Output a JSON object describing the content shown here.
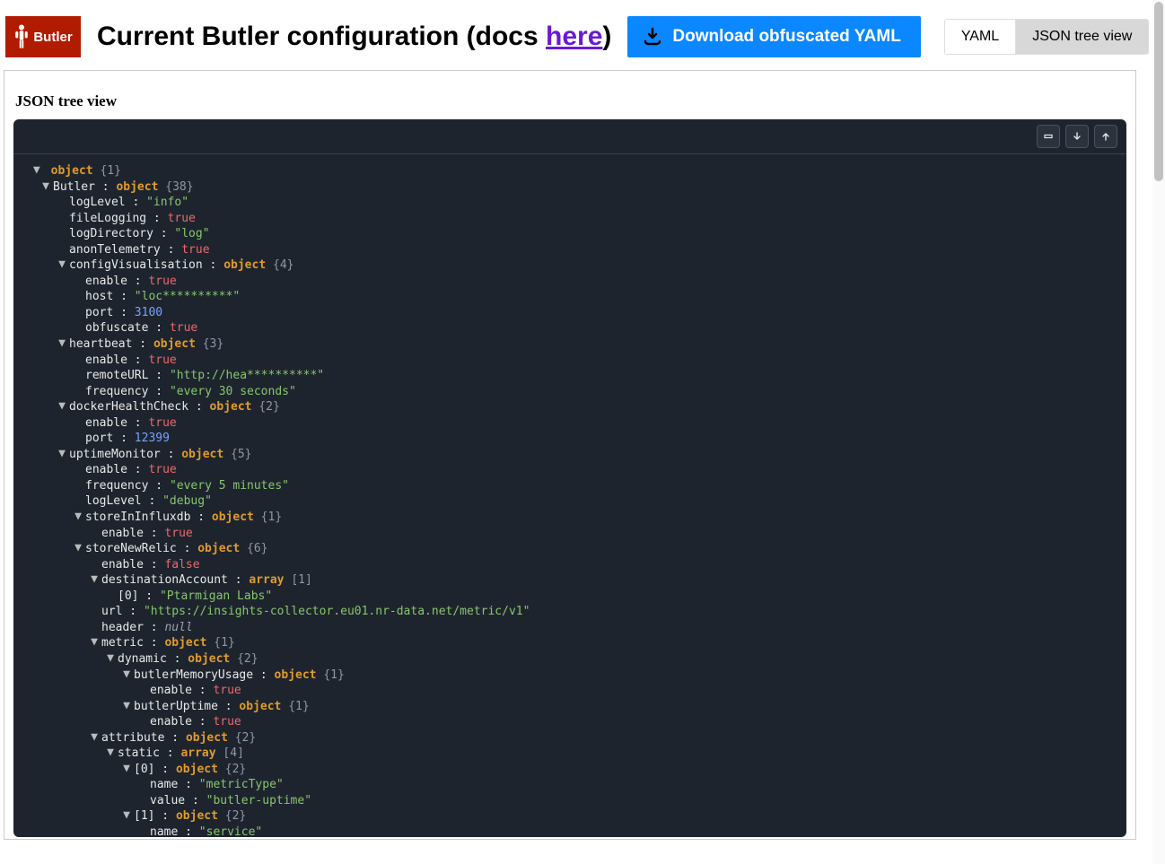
{
  "logo": {
    "text": "Butler"
  },
  "title": {
    "prefix": "Current Butler configuration (docs ",
    "link": "here",
    "suffix": ")"
  },
  "download_btn": "Download obfuscated YAML",
  "tabs": {
    "yaml": "YAML",
    "json": "JSON tree view"
  },
  "section_heading": "JSON tree view",
  "tree_root": {
    "label": "object",
    "count": "{1}"
  },
  "rows": [
    {
      "depth": 1,
      "toggle": true,
      "key": "Butler",
      "sep": " : ",
      "type": "object",
      "count": "{38}"
    },
    {
      "depth": 2,
      "key": "logLevel",
      "sep": " : ",
      "valueKind": "str",
      "value": "\"info\""
    },
    {
      "depth": 2,
      "key": "fileLogging",
      "sep": " : ",
      "valueKind": "bool",
      "value": "true"
    },
    {
      "depth": 2,
      "key": "logDirectory",
      "sep": " : ",
      "valueKind": "str",
      "value": "\"log\""
    },
    {
      "depth": 2,
      "key": "anonTelemetry",
      "sep": " : ",
      "valueKind": "bool",
      "value": "true"
    },
    {
      "depth": 2,
      "toggle": true,
      "key": "configVisualisation",
      "sep": " : ",
      "type": "object",
      "count": "{4}"
    },
    {
      "depth": 3,
      "key": "enable",
      "sep": " : ",
      "valueKind": "bool",
      "value": "true"
    },
    {
      "depth": 3,
      "key": "host",
      "sep": " : ",
      "valueKind": "str",
      "value": "\"loc**********\""
    },
    {
      "depth": 3,
      "key": "port",
      "sep": " : ",
      "valueKind": "num",
      "value": "3100"
    },
    {
      "depth": 3,
      "key": "obfuscate",
      "sep": " : ",
      "valueKind": "bool",
      "value": "true"
    },
    {
      "depth": 2,
      "toggle": true,
      "key": "heartbeat",
      "sep": " : ",
      "type": "object",
      "count": "{3}"
    },
    {
      "depth": 3,
      "key": "enable",
      "sep": " : ",
      "valueKind": "bool",
      "value": "true"
    },
    {
      "depth": 3,
      "key": "remoteURL",
      "sep": " : ",
      "valueKind": "str",
      "value": "\"http://hea**********\""
    },
    {
      "depth": 3,
      "key": "frequency",
      "sep": " : ",
      "valueKind": "str",
      "value": "\"every 30 seconds\""
    },
    {
      "depth": 2,
      "toggle": true,
      "key": "dockerHealthCheck",
      "sep": " : ",
      "type": "object",
      "count": "{2}"
    },
    {
      "depth": 3,
      "key": "enable",
      "sep": " : ",
      "valueKind": "bool",
      "value": "true"
    },
    {
      "depth": 3,
      "key": "port",
      "sep": " : ",
      "valueKind": "num",
      "value": "12399"
    },
    {
      "depth": 2,
      "toggle": true,
      "key": "uptimeMonitor",
      "sep": " : ",
      "type": "object",
      "count": "{5}"
    },
    {
      "depth": 3,
      "key": "enable",
      "sep": " : ",
      "valueKind": "bool",
      "value": "true"
    },
    {
      "depth": 3,
      "key": "frequency",
      "sep": " : ",
      "valueKind": "str",
      "value": "\"every 5 minutes\""
    },
    {
      "depth": 3,
      "key": "logLevel",
      "sep": " : ",
      "valueKind": "str",
      "value": "\"debug\""
    },
    {
      "depth": 3,
      "toggle": true,
      "key": "storeInInfluxdb",
      "sep": " : ",
      "type": "object",
      "count": "{1}"
    },
    {
      "depth": 4,
      "key": "enable",
      "sep": " : ",
      "valueKind": "bool",
      "value": "true"
    },
    {
      "depth": 3,
      "toggle": true,
      "key": "storeNewRelic",
      "sep": " : ",
      "type": "object",
      "count": "{6}"
    },
    {
      "depth": 4,
      "key": "enable",
      "sep": " : ",
      "valueKind": "bool",
      "value": "false"
    },
    {
      "depth": 4,
      "toggle": true,
      "key": "destinationAccount",
      "sep": " : ",
      "type": "array",
      "count": "[1]"
    },
    {
      "depth": 5,
      "key": "[0]",
      "sep": " : ",
      "valueKind": "str",
      "value": "\"Ptarmigan Labs\""
    },
    {
      "depth": 4,
      "key": "url",
      "sep": " : ",
      "valueKind": "str",
      "value": "\"https://insights-collector.eu01.nr-data.net/metric/v1\""
    },
    {
      "depth": 4,
      "key": "header",
      "sep": " : ",
      "valueKind": "null",
      "value": "null"
    },
    {
      "depth": 4,
      "toggle": true,
      "key": "metric",
      "sep": " : ",
      "type": "object",
      "count": "{1}"
    },
    {
      "depth": 5,
      "toggle": true,
      "key": "dynamic",
      "sep": " : ",
      "type": "object",
      "count": "{2}"
    },
    {
      "depth": 6,
      "toggle": true,
      "key": "butlerMemoryUsage",
      "sep": " : ",
      "type": "object",
      "count": "{1}"
    },
    {
      "depth": 7,
      "key": "enable",
      "sep": " : ",
      "valueKind": "bool",
      "value": "true"
    },
    {
      "depth": 6,
      "toggle": true,
      "key": "butlerUptime",
      "sep": " : ",
      "type": "object",
      "count": "{1}"
    },
    {
      "depth": 7,
      "key": "enable",
      "sep": " : ",
      "valueKind": "bool",
      "value": "true"
    },
    {
      "depth": 4,
      "toggle": true,
      "key": "attribute",
      "sep": " : ",
      "type": "object",
      "count": "{2}"
    },
    {
      "depth": 5,
      "toggle": true,
      "key": "static",
      "sep": " : ",
      "type": "array",
      "count": "[4]"
    },
    {
      "depth": 6,
      "toggle": true,
      "key": "[0]",
      "sep": " : ",
      "type": "object",
      "count": "{2}"
    },
    {
      "depth": 7,
      "key": "name",
      "sep": " : ",
      "valueKind": "str",
      "value": "\"metricType\""
    },
    {
      "depth": 7,
      "key": "value",
      "sep": " : ",
      "valueKind": "str",
      "value": "\"butler-uptime\""
    },
    {
      "depth": 6,
      "toggle": true,
      "key": "[1]",
      "sep": " : ",
      "type": "object",
      "count": "{2}"
    },
    {
      "depth": 7,
      "key": "name",
      "sep": " : ",
      "valueKind": "str",
      "value": "\"service\""
    }
  ]
}
